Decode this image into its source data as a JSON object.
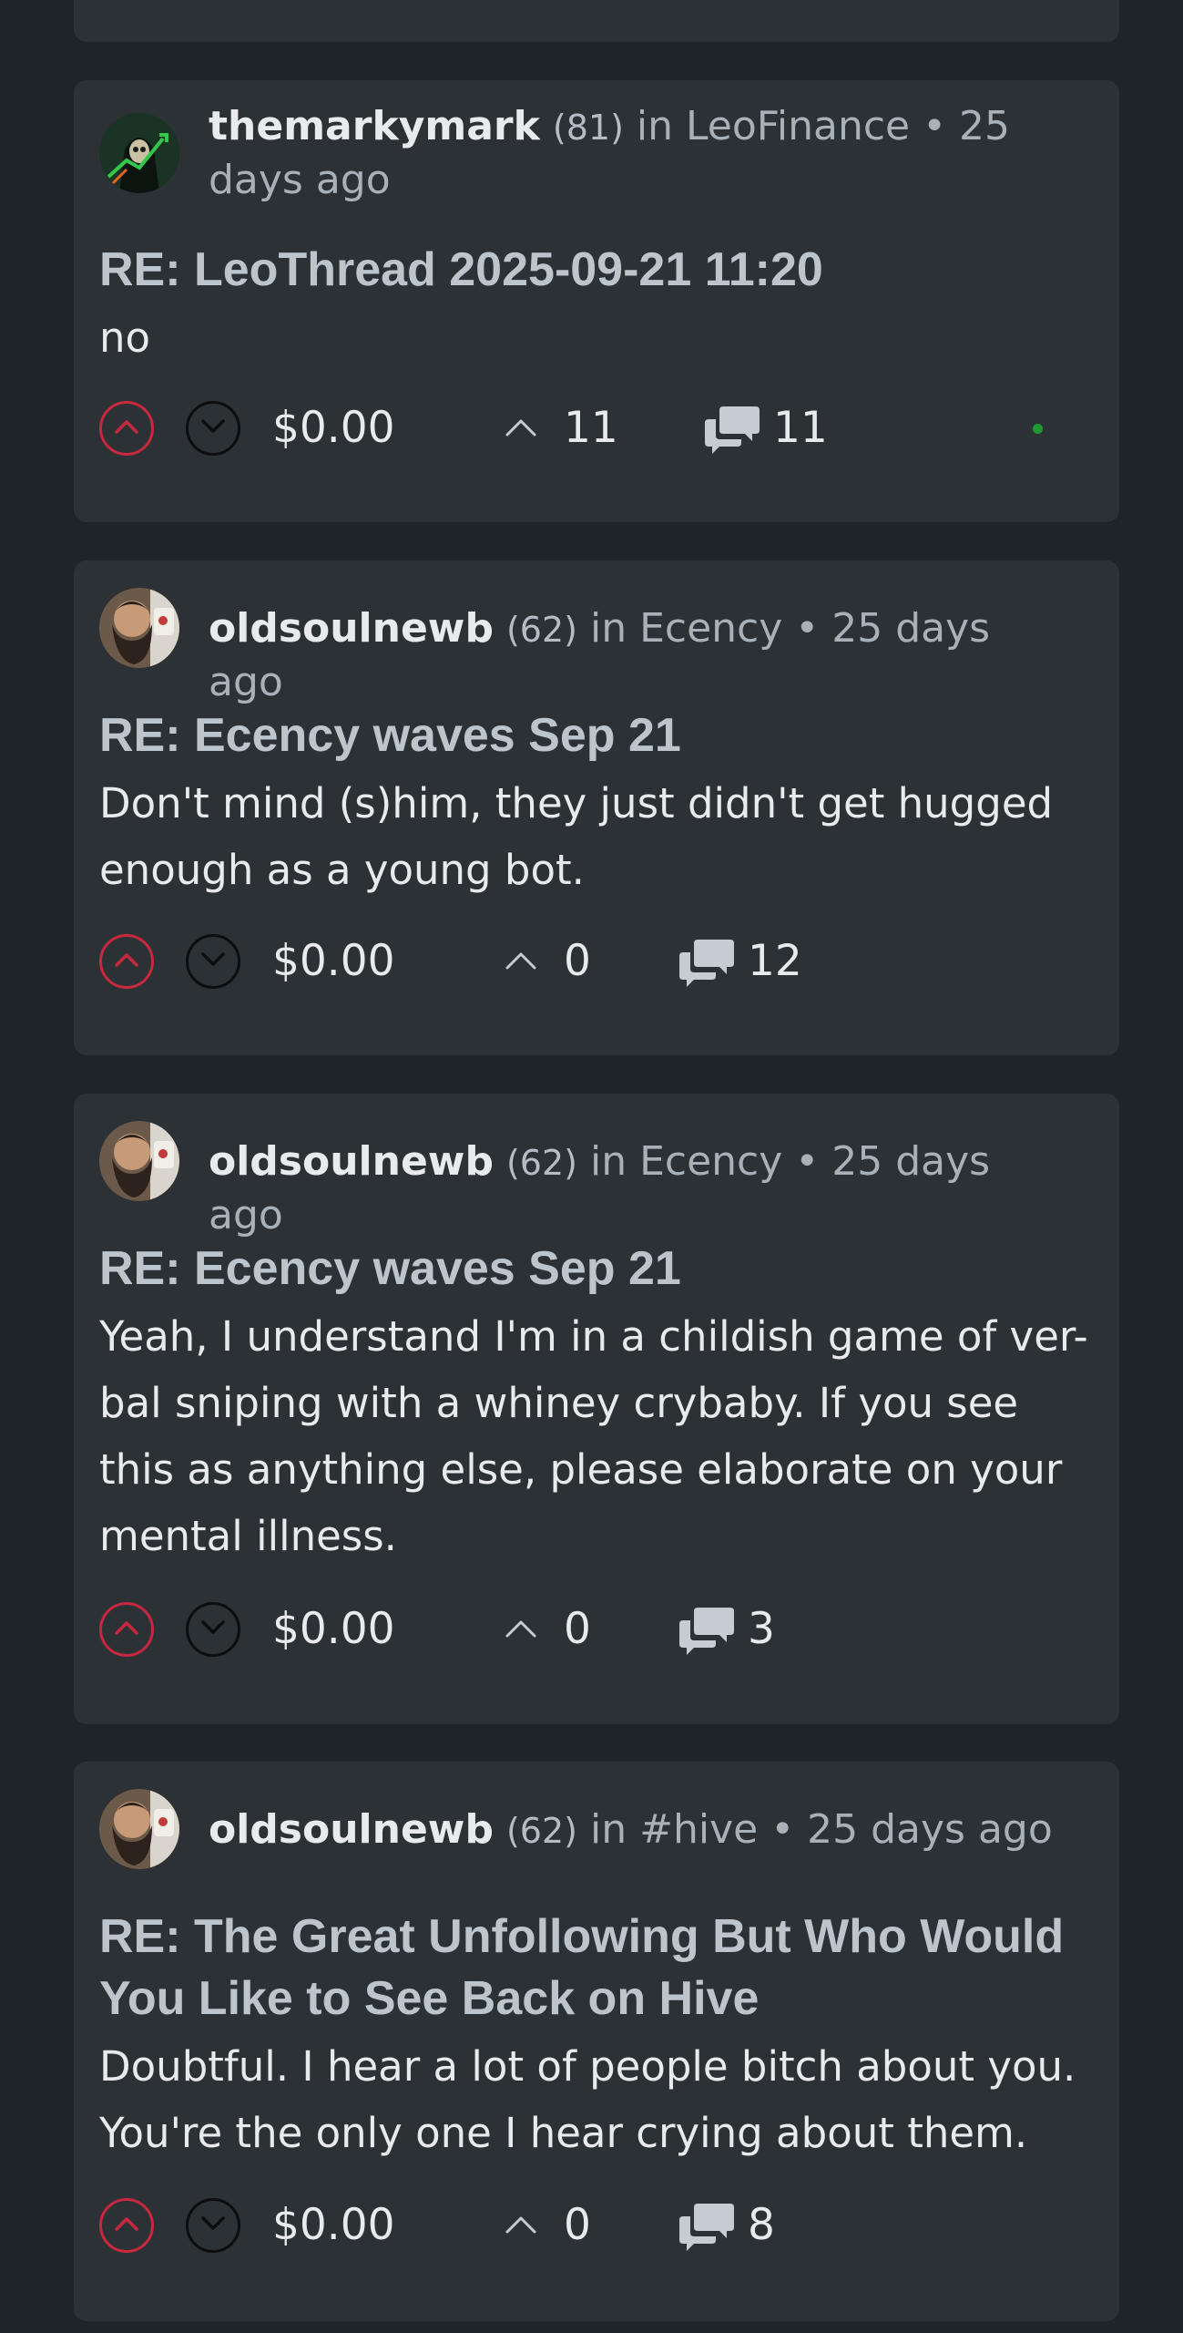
{
  "colors": {
    "background": "#1f2428",
    "card": "#2c3136",
    "upvote_ring": "#c8283e",
    "online_dot": "#1e9b2e"
  },
  "posts": [
    {
      "author": "themarkymark",
      "reputation": "(81)",
      "in_label": "in",
      "community": "LeoFinance",
      "separator": "•",
      "time": "25 days ago",
      "title": "RE: LeoThread 2025-09-21 11:20",
      "body": "no",
      "payout": "$0.00",
      "reblogs": "11",
      "comments": "11",
      "avatar_icon": "grim-reaper-avatar"
    },
    {
      "author": "oldsoulnewb",
      "reputation": "(62)",
      "in_label": "in",
      "community": "Ecency",
      "separator": "•",
      "time": "25 days ago",
      "title": "RE: Ecency waves Sep 21",
      "body": "Don't mind (s)him, they just didn't get hugged enough as a young bot.",
      "payout": "$0.00",
      "reblogs": "0",
      "comments": "12",
      "avatar_icon": "bearded-man-avatar"
    },
    {
      "author": "oldsoulnewb",
      "reputation": "(62)",
      "in_label": "in",
      "community": "Ecency",
      "separator": "•",
      "time": "25 days ago",
      "title": "RE: Ecency waves Sep 21",
      "body": "Yeah, I understand I'm in a childish game of ver-bal sniping with a whiney crybaby. If you see this as anything else, please elaborate on your mental illness.",
      "payout": "$0.00",
      "reblogs": "0",
      "comments": "3",
      "avatar_icon": "bearded-man-avatar"
    },
    {
      "author": "oldsoulnewb",
      "reputation": "(62)",
      "in_label": "in",
      "community": "#hive",
      "separator": "•",
      "time": "25 days ago",
      "title": "RE: The Great Unfollowing But Who Would You Like to See Back on Hive",
      "body": "Doubtful. I hear a lot of people bitch about you. You're the only one I hear crying about them.",
      "payout": "$0.00",
      "reblogs": "0",
      "comments": "8",
      "avatar_icon": "bearded-man-avatar"
    }
  ]
}
